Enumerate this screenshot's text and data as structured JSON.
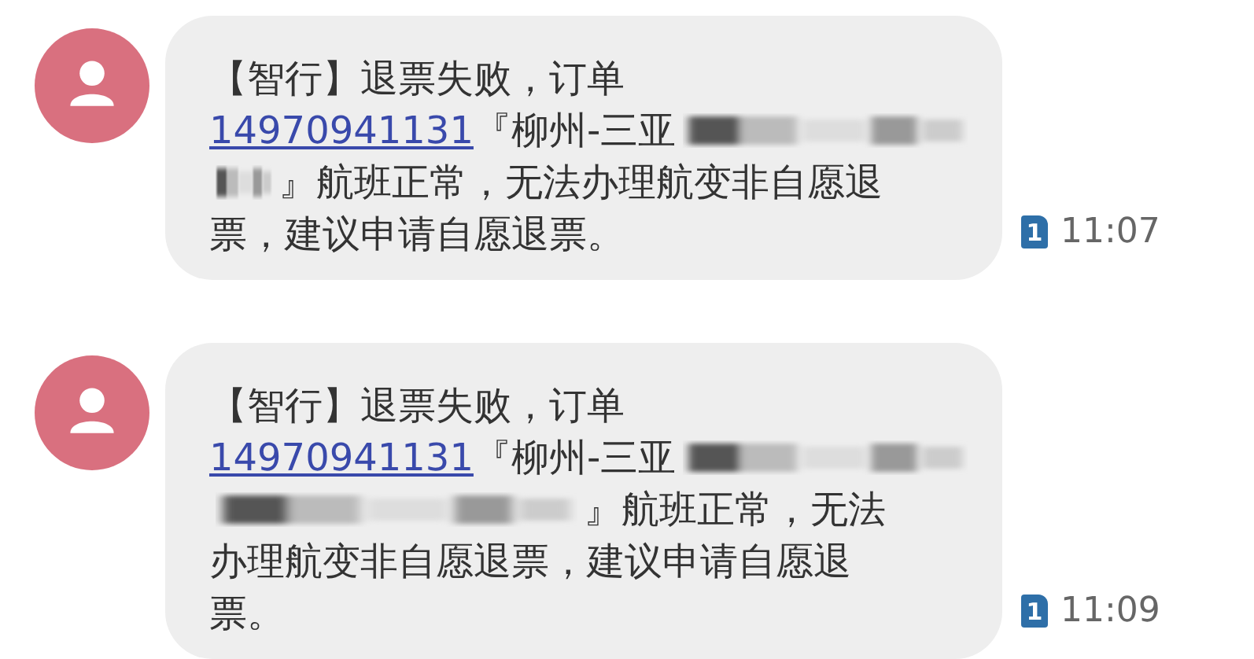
{
  "messages": [
    {
      "lines": [
        [
          {
            "kind": "text",
            "text": "【智行】退票失败，订单"
          }
        ],
        [
          {
            "kind": "link",
            "text": "14970941131"
          },
          {
            "kind": "text",
            "text": "『柳州-三亚"
          },
          {
            "kind": "redacted"
          }
        ],
        [
          {
            "kind": "redacted"
          },
          {
            "kind": "text",
            "text": "』航班正常，无法办理航变非自愿退"
          }
        ],
        [
          {
            "kind": "text",
            "text": "票，建议申请自愿退票。"
          }
        ]
      ],
      "sim": "1",
      "time": "11:07"
    },
    {
      "lines": [
        [
          {
            "kind": "text",
            "text": "【智行】退票失败，订单"
          }
        ],
        [
          {
            "kind": "link",
            "text": "14970941131"
          },
          {
            "kind": "text",
            "text": "『柳州-三亚"
          },
          {
            "kind": "redacted"
          }
        ],
        [
          {
            "kind": "redacted"
          },
          {
            "kind": "text",
            "text": "』航班正常，无法"
          }
        ],
        [
          {
            "kind": "text",
            "text": "办理航变非自愿退票，建议申请自愿退"
          }
        ],
        [
          {
            "kind": "text",
            "text": "票。"
          }
        ]
      ],
      "sim": "1",
      "time": "11:09"
    }
  ]
}
